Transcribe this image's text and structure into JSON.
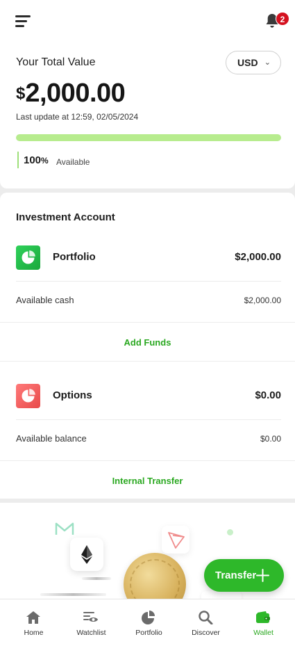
{
  "header": {
    "menu_icon": "hamburger-menu-icon",
    "notification_icon": "bell-icon",
    "notification_count": "2"
  },
  "total": {
    "label": "Your Total Value",
    "currency": "USD",
    "currency_symbol": "$",
    "amount": "2,000.00",
    "last_update": "Last update at 12:59, 02/05/2024",
    "available_percent_value": 100,
    "available_percent": "100",
    "percent_sign": "%",
    "available_label": "Available",
    "progress_color": "#b7ec8e"
  },
  "investment": {
    "title": "Investment Account",
    "portfolio": {
      "name": "Portfolio",
      "value": "$2,000.00",
      "sub_label": "Available cash",
      "sub_value": "$2,000.00",
      "action": "Add Funds",
      "icon": "pie-chart-icon",
      "icon_color": "#1fb845"
    },
    "options": {
      "name": "Options",
      "value": "$0.00",
      "sub_label": "Available balance",
      "sub_value": "$0.00",
      "action": "Internal Transfer",
      "icon": "pie-chart-icon",
      "icon_color": "#ef5a5a"
    }
  },
  "fab": {
    "label": "Transfer",
    "icon": "plus-icon"
  },
  "nav": {
    "items": [
      {
        "label": "Home",
        "icon": "home-icon"
      },
      {
        "label": "Watchlist",
        "icon": "watchlist-eye-icon"
      },
      {
        "label": "Portfolio",
        "icon": "pie-chart-icon"
      },
      {
        "label": "Discover",
        "icon": "search-icon"
      },
      {
        "label": "Wallet",
        "icon": "wallet-icon"
      }
    ],
    "active": "Wallet"
  },
  "colors": {
    "accent": "#2aa820",
    "badge": "#d4111f"
  }
}
